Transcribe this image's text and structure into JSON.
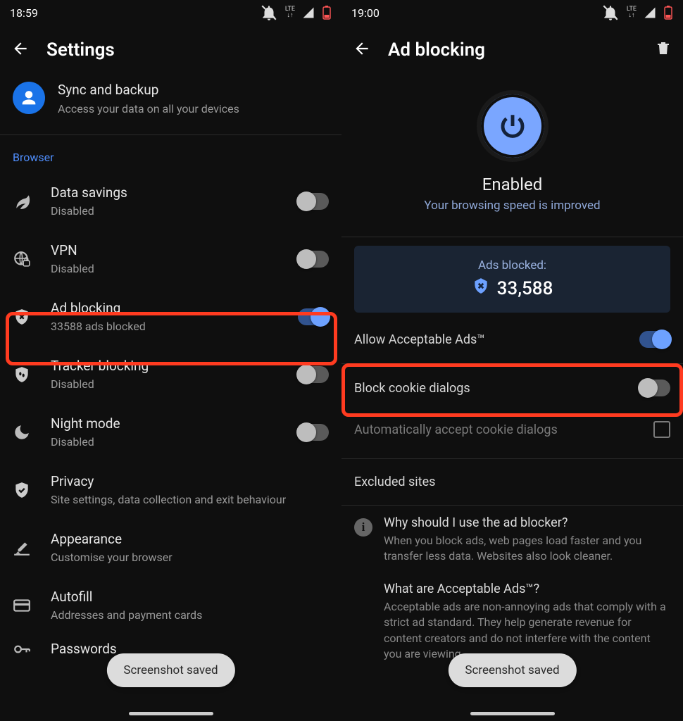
{
  "left": {
    "time": "18:59",
    "title": "Settings",
    "sync": {
      "title": "Sync and backup",
      "sub": "Access your data on all your devices"
    },
    "section": "Browser",
    "rows": {
      "data_savings": {
        "title": "Data savings",
        "sub": "Disabled"
      },
      "vpn": {
        "title": "VPN",
        "sub": "Disabled"
      },
      "ad_blocking": {
        "title": "Ad blocking",
        "sub": "33588 ads blocked"
      },
      "tracker": {
        "title": "Tracker blocking",
        "sub": "Disabled"
      },
      "night": {
        "title": "Night mode",
        "sub": "Disabled"
      },
      "privacy": {
        "title": "Privacy",
        "sub": "Site settings, data collection and exit behaviour"
      },
      "appearance": {
        "title": "Appearance",
        "sub": "Customise your browser"
      },
      "autofill": {
        "title": "Autofill",
        "sub": "Addresses and payment cards"
      },
      "passwords": {
        "title": "Passwords"
      }
    },
    "toast": "Screenshot saved"
  },
  "right": {
    "time": "19:00",
    "title": "Ad blocking",
    "enabled_title": "Enabled",
    "enabled_sub": "Your browsing speed is improved",
    "stat_label": "Ads blocked:",
    "stat_value": "33,588",
    "allow_ads": "Allow Acceptable Ads™",
    "block_cookie": "Block cookie dialogs",
    "auto_accept": "Automatically accept cookie dialogs",
    "excluded": "Excluded sites",
    "info1_q": "Why should I use the ad blocker?",
    "info1_a": "When you block ads, web pages load faster and you transfer less data. Websites also look cleaner.",
    "info2_q": "What are Acceptable Ads™?",
    "info2_a": "Acceptable ads are non-annoying ads that comply with a strict ad standard. They help generate revenue for content creators and do not interfere with the content you are viewing.",
    "toast": "Screenshot saved"
  }
}
